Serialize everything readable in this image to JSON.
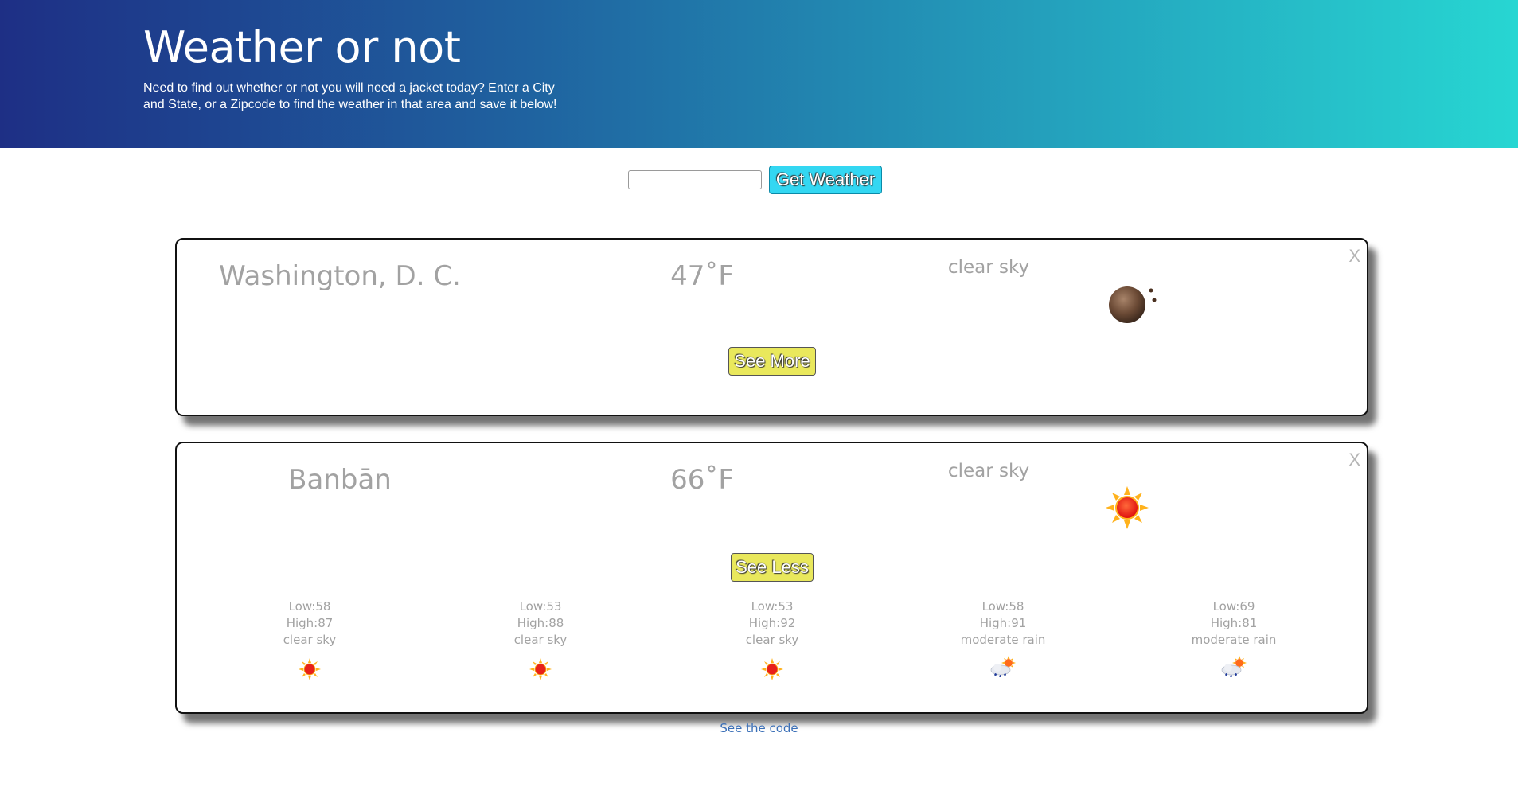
{
  "header": {
    "title": "Weather or not",
    "description": "Need to find out whether or not you will need a jacket today? Enter a City and State, or a Zipcode to find the weather in that area and save it below!"
  },
  "search": {
    "value": "",
    "placeholder": "",
    "button_label": "Get Weather"
  },
  "cards": [
    {
      "city": "Washington, D. C.",
      "temp": "47˚F",
      "description": "clear sky",
      "icon": "clear-night-moon-icon",
      "close_label": "X",
      "toggle_label": "See More"
    },
    {
      "city": "Banbān",
      "temp": "66˚F",
      "description": "clear sky",
      "icon": "sun-icon",
      "close_label": "X",
      "toggle_label": "See Less",
      "forecast": [
        {
          "low": "Low:58",
          "high": "High:87",
          "description": "clear sky",
          "icon": "sun-icon"
        },
        {
          "low": "Low:53",
          "high": "High:88",
          "description": "clear sky",
          "icon": "sun-icon"
        },
        {
          "low": "Low:53",
          "high": "High:92",
          "description": "clear sky",
          "icon": "sun-icon"
        },
        {
          "low": "Low:58",
          "high": "High:91",
          "description": "moderate rain",
          "icon": "rain-cloud-sun-icon"
        },
        {
          "low": "Low:69",
          "high": "High:81",
          "description": "moderate rain",
          "icon": "rain-cloud-sun-icon"
        }
      ]
    }
  ],
  "footer": {
    "link_label": "See the code"
  },
  "colors": {
    "header_start": "#1e2f85",
    "header_end": "#27d6d2",
    "search_button": "#33d7f2",
    "toggle_button": "#e9e85c",
    "link": "#3a6fb7"
  }
}
